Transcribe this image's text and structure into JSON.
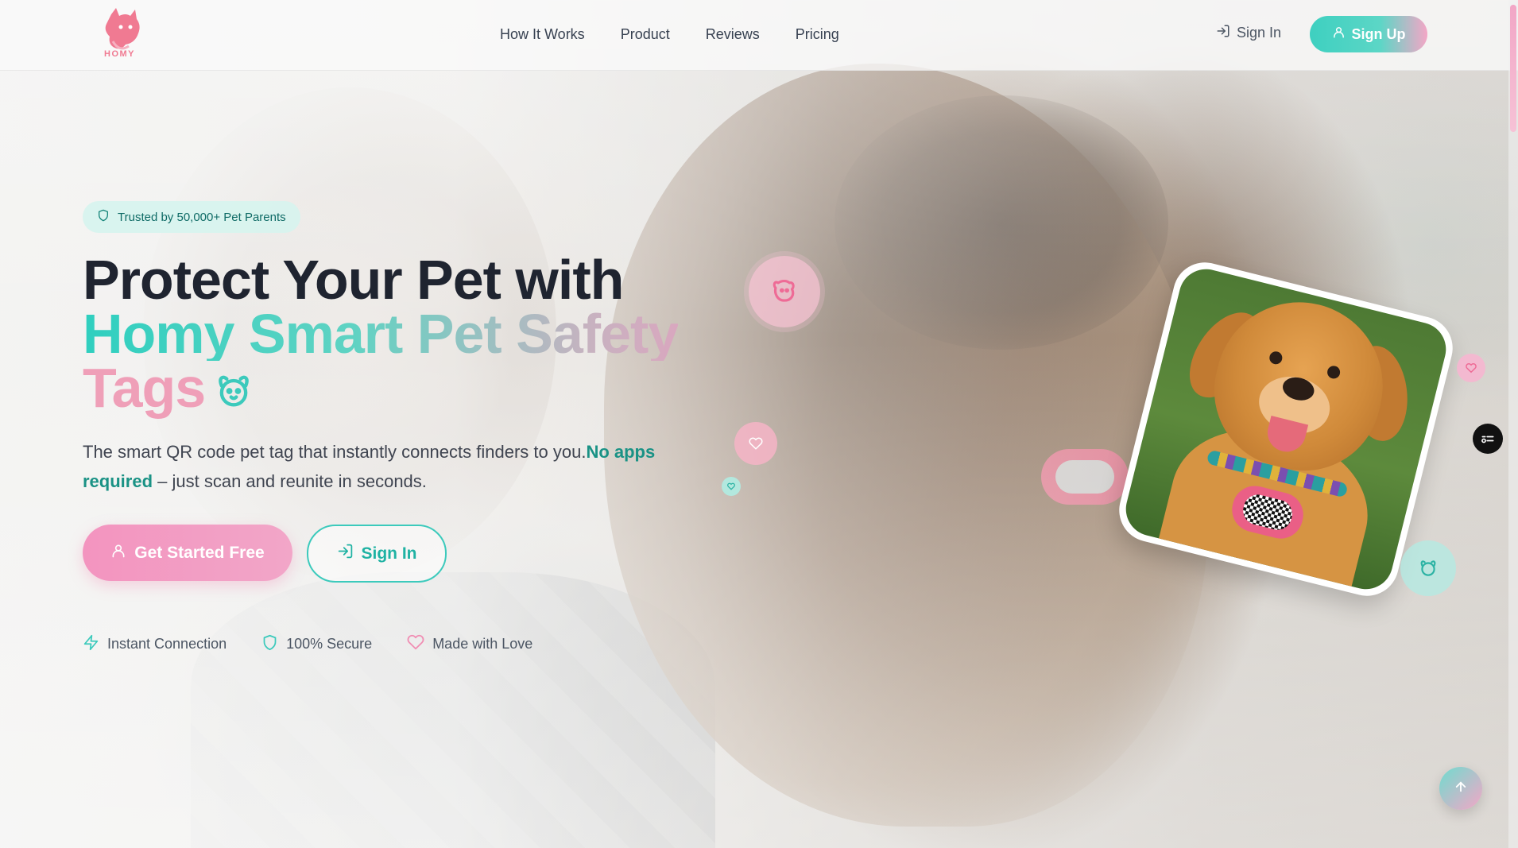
{
  "brand": {
    "name": "HOMY",
    "accent_teal": "#3ecfbf",
    "accent_pink": "#f394bf"
  },
  "header": {
    "nav": [
      "How It Works",
      "Product",
      "Reviews",
      "Pricing"
    ],
    "sign_in": "Sign In",
    "sign_up": "Sign Up"
  },
  "hero": {
    "badge": "Trusted by 50,000+ Pet Parents",
    "title_line1": "Protect Your Pet with",
    "title_line2": "Homy Smart Pet Safety",
    "title_line3": "Tags",
    "subtitle_start": "The smart QR code pet tag that instantly connects finders to you.",
    "subtitle_bold": "No apps required",
    "subtitle_end": " – just scan and reunite in seconds.",
    "cta_primary": "Get Started Free",
    "cta_secondary": "Sign In",
    "features": [
      "Instant Connection",
      "100% Secure",
      "Made with Love"
    ]
  },
  "icons": {
    "logo": "dog-logo-icon",
    "sign_in": "log-in-icon",
    "sign_up": "user-icon",
    "badge": "shield-icon",
    "title_paw": "dog-face-icon",
    "feature_1": "zap-icon",
    "feature_2": "shield-icon",
    "feature_3": "heart-icon",
    "scroll_top": "arrow-up-icon"
  }
}
